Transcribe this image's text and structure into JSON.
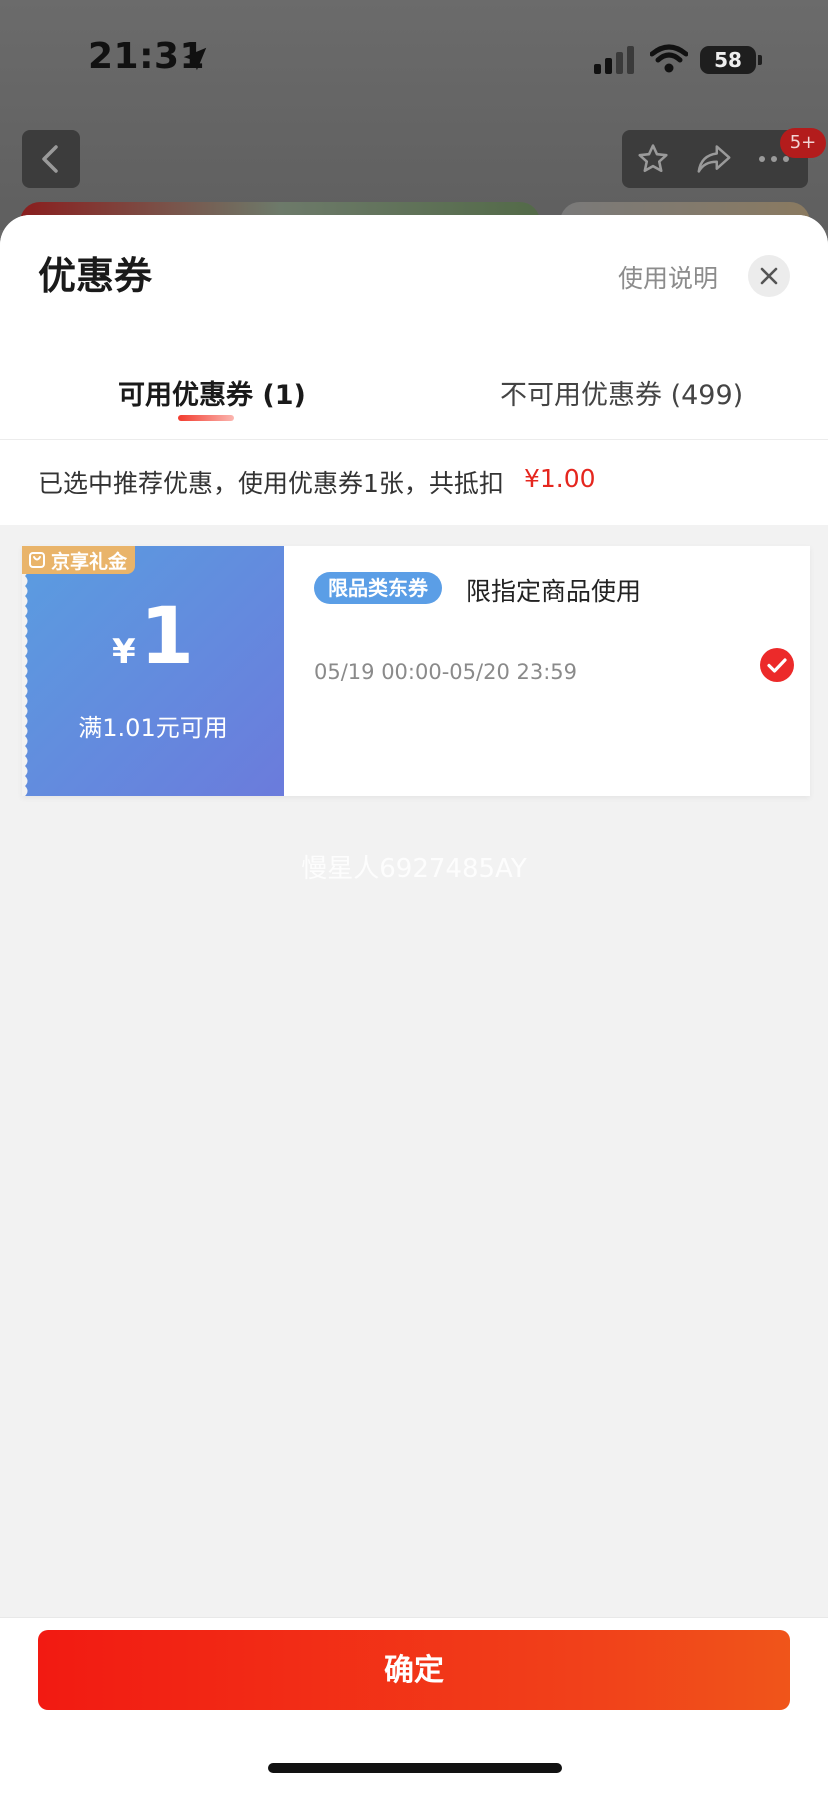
{
  "status_bar": {
    "time": "21:31",
    "battery": "58"
  },
  "background_page": {
    "notification_badge": "5+"
  },
  "sheet": {
    "title": "优惠券",
    "help_link": "使用说明",
    "tabs": [
      {
        "label": "可用优惠券 (1)",
        "active": true
      },
      {
        "label": "不可用优惠券 (499)",
        "active": false
      }
    ],
    "summary": {
      "text": "已选中推荐优惠，使用优惠券1张，共抵扣",
      "amount": "¥1.00"
    },
    "coupon": {
      "tag": "京享礼金",
      "currency": "¥",
      "value": "1",
      "condition": "满1.01元可用",
      "category_badge": "限品类东券",
      "description": "限指定商品使用",
      "period": "05/19 00:00-05/20 23:59",
      "selected": true
    },
    "watermark": "慢星人6927485AY",
    "confirm_label": "确定"
  },
  "colors": {
    "accent_red": "#e5261e",
    "coupon_gradient_start": "#5a9de0",
    "coupon_gradient_end": "#6b7bdc",
    "tag_gold": "#e9b46a"
  }
}
